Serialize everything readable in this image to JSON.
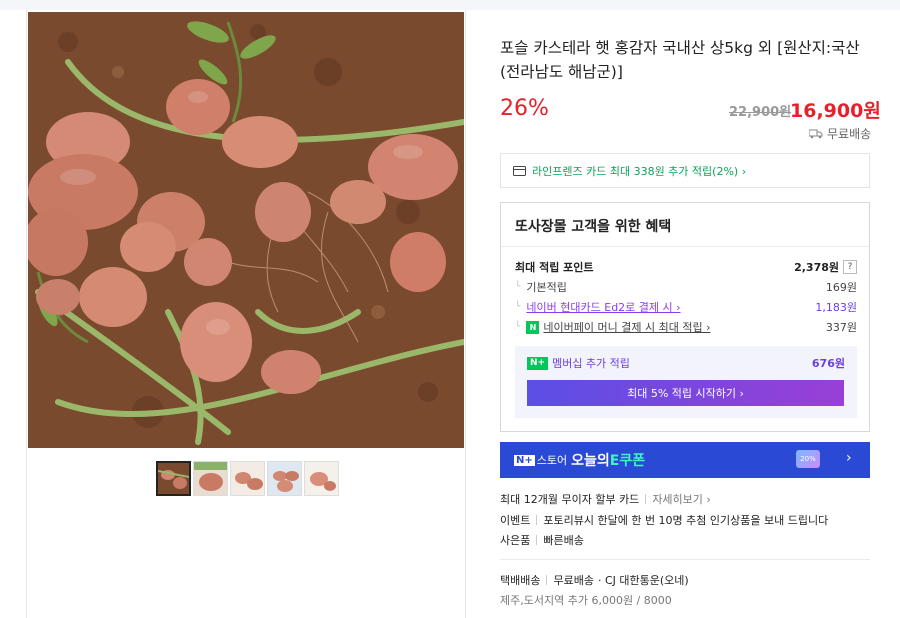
{
  "product": {
    "title": "포슬 카스테라 햇 홍감자 국내산 상5kg 외 [원산지:국산(전라남도 해남군)]",
    "discount": "26%",
    "original_price": "22,900원",
    "sale_price": "16,900원",
    "shipping": "무료배송"
  },
  "card_promo": "라인프렌즈 카드 최대 338원 추가 적립(2%) ›",
  "benefits": {
    "title": "또사장몰 고객을 위한 혜택",
    "max_points_label": "최대 적립 포인트",
    "max_points_value": "2,378원",
    "help": "?",
    "basic_label": "기본적립",
    "basic_value": "169원",
    "card_label": "네이버 현대카드 Ed2로 결제 시 ›",
    "card_value": "1,183원",
    "npay_label": "네이버페이 머니 결제 시 최대 적립 ›",
    "npay_badge": "N",
    "npay_value": "337원",
    "member_label": "멤버십 추가 적립",
    "member_badge": "N+",
    "member_value": "676원",
    "member_button": "최대 5% 적립 시작하기 ›"
  },
  "coupon": {
    "n": "N+",
    "store": "스토어",
    "today": "오늘의",
    "coupon": "E쿠폰",
    "badge": "20%",
    "chevron": "›"
  },
  "installment": {
    "label": "최대 12개월 무이자 할부 카드",
    "link": "자세히보기 ›"
  },
  "event": {
    "label": "이벤트",
    "text": "포토리뷰시 한달에 한 번 10명 추첨 인기상품을 보내 드립니다"
  },
  "gift": {
    "label": "사은품",
    "text": "빠른배송"
  },
  "delivery": {
    "method": "택배배송",
    "free": "무료배송",
    "carrier": "· CJ 대한통운(오네)",
    "extra": "제주,도서지역 추가 6,000원 / 8000"
  },
  "colors": {
    "accent_red": "#e6212b",
    "naver_green": "#03c75a",
    "member_purple": "#6b3fe0",
    "coupon_blue": "#2a49d4"
  }
}
